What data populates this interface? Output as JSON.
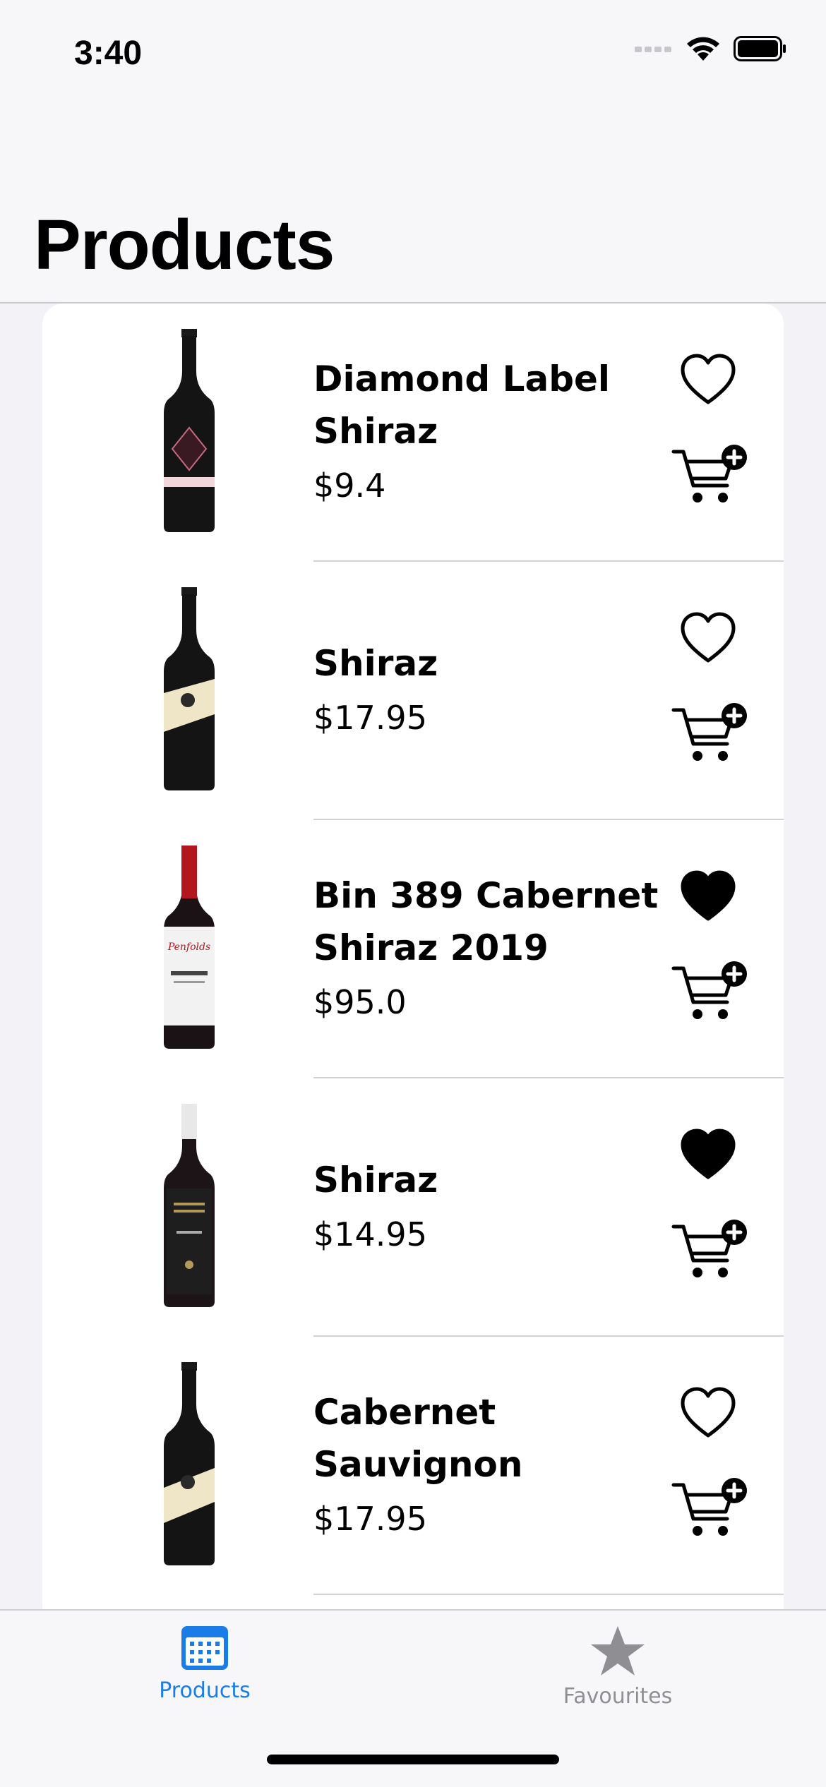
{
  "status_bar": {
    "time": "3:40"
  },
  "header": {
    "title": "Products"
  },
  "products": [
    {
      "name": "Diamond Label Shiraz",
      "price": "$9.4",
      "favourite": false,
      "label_style": "rosemount-diamond"
    },
    {
      "name": "Shiraz",
      "price": "$17.95",
      "favourite": false,
      "label_style": "cream-band"
    },
    {
      "name": "Bin 389 Cabernet Shiraz 2019",
      "price": "$95.0",
      "favourite": true,
      "label_style": "penfolds-white"
    },
    {
      "name": "Shiraz",
      "price": "$14.95",
      "favourite": true,
      "label_style": "black-label"
    },
    {
      "name": "Cabernet Sauvignon",
      "price": "$17.95",
      "favourite": false,
      "label_style": "cream-band"
    }
  ],
  "tab_bar": {
    "tabs": [
      {
        "label": "Products",
        "icon": "calendar-icon",
        "active": true
      },
      {
        "label": "Favourites",
        "icon": "star-icon",
        "active": false
      }
    ],
    "active_color": "#1a7ce6",
    "inactive_color": "#8e8e93"
  }
}
